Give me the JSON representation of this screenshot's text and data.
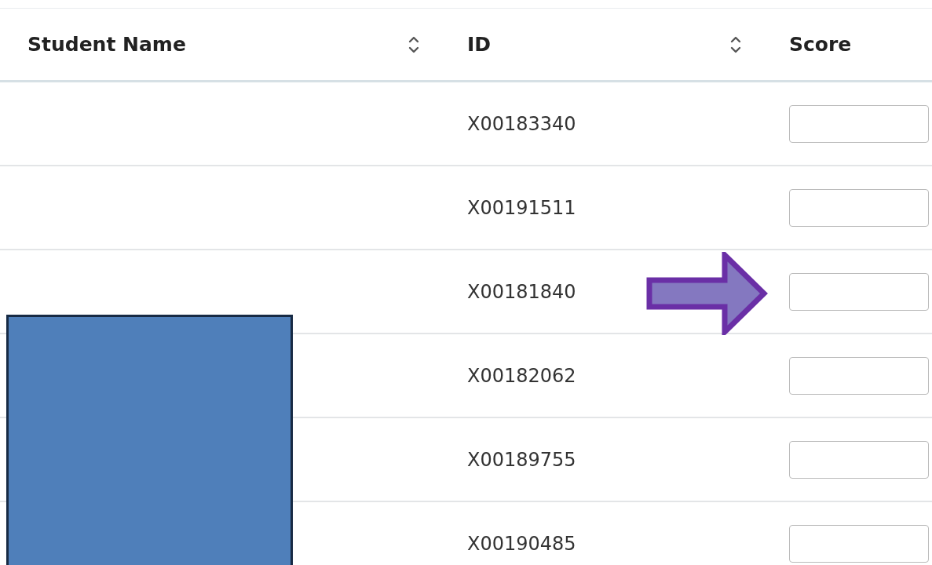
{
  "table": {
    "columns": [
      {
        "label": "Student Name",
        "sortable": true
      },
      {
        "label": "ID",
        "sortable": true
      },
      {
        "label": "Score",
        "sortable": false
      }
    ],
    "names_redacted": true,
    "rows": [
      {
        "id": "X00183340",
        "arrow": false
      },
      {
        "id": "X00191511",
        "arrow": false
      },
      {
        "id": "X00181840",
        "arrow": true
      },
      {
        "id": "X00182062",
        "arrow": false
      },
      {
        "id": "X00189755",
        "arrow": false
      },
      {
        "id": "X00190485",
        "arrow": false
      }
    ]
  }
}
